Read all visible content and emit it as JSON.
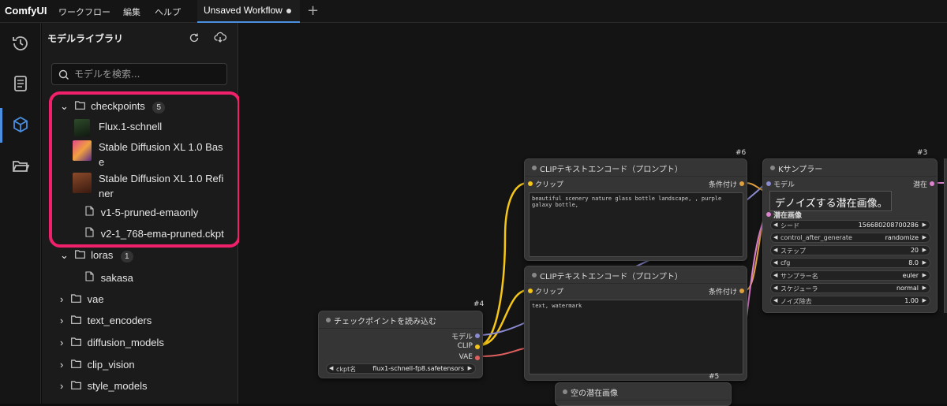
{
  "topbar": {
    "logo": "ComfyUI",
    "menu": [
      "ワークフロー",
      "編集",
      "ヘルプ"
    ],
    "tab_label": "Unsaved Workflow"
  },
  "iconbar": [
    "history-icon",
    "document-icon",
    "cube-icon",
    "folder-open-icon"
  ],
  "panel": {
    "title": "モデルライブラリ",
    "search_placeholder": "モデルを検索..."
  },
  "tree": {
    "checkpoints": {
      "label": "checkpoints",
      "count": "5"
    },
    "items": [
      "Flux.1-schnell",
      "Stable Diffusion XL 1.0 Base",
      "Stable Diffusion XL 1.0 Refiner",
      "v1-5-pruned-emaonly",
      "v2-1_768-ema-pruned.ckpt"
    ],
    "item_lines": {
      "sdxl_base_1": "Stable Diffusion XL 1.0 Bas",
      "sdxl_base_2": "e",
      "sdxl_ref_1": "Stable Diffusion XL 1.0 Refi",
      "sdxl_ref_2": "ner"
    },
    "loras": {
      "label": "loras",
      "count": "1"
    },
    "lora_items": [
      "sakasa"
    ],
    "folders": [
      "vae",
      "text_encoders",
      "diffusion_models",
      "clip_vision",
      "style_models"
    ]
  },
  "nodes": {
    "clip1": {
      "id": "#6",
      "title": "CLIPテキストエンコード（プロンプト）",
      "in": "クリップ",
      "out": "条件付け",
      "text": "beautiful scenery nature glass bottle landscape, , purple galaxy bottle,"
    },
    "clip2": {
      "id": "",
      "title": "CLIPテキストエンコード（プロンプト）",
      "in": "クリップ",
      "out": "条件付け",
      "text": "text, watermark"
    },
    "ksampler": {
      "id": "#3",
      "title": "Kサンプラー",
      "in_model": "モデル",
      "out": "潜在",
      "in_latent": "潜在画像",
      "widgets": [
        {
          "label": "シード",
          "value": "156680208700286"
        },
        {
          "label": "control_after_generate",
          "value": "randomize"
        },
        {
          "label": "ステップ",
          "value": "20"
        },
        {
          "label": "cfg",
          "value": "8.0"
        },
        {
          "label": "サンプラー名",
          "value": "euler"
        },
        {
          "label": "スケジューラ",
          "value": "normal"
        },
        {
          "label": "ノイズ除去",
          "value": "1.00"
        }
      ]
    },
    "ckpt": {
      "id": "#4",
      "title": "チェックポイントを読み込む",
      "out_model": "モデル",
      "out_clip": "CLIP",
      "out_vae": "VAE",
      "widget_label": "ckpt名",
      "widget_value": "flux1-schnell-fp8.safetensors"
    },
    "latent": {
      "id": "#5",
      "title": "空の潜在画像"
    }
  },
  "tooltip": "デノイズする潜在画像。"
}
